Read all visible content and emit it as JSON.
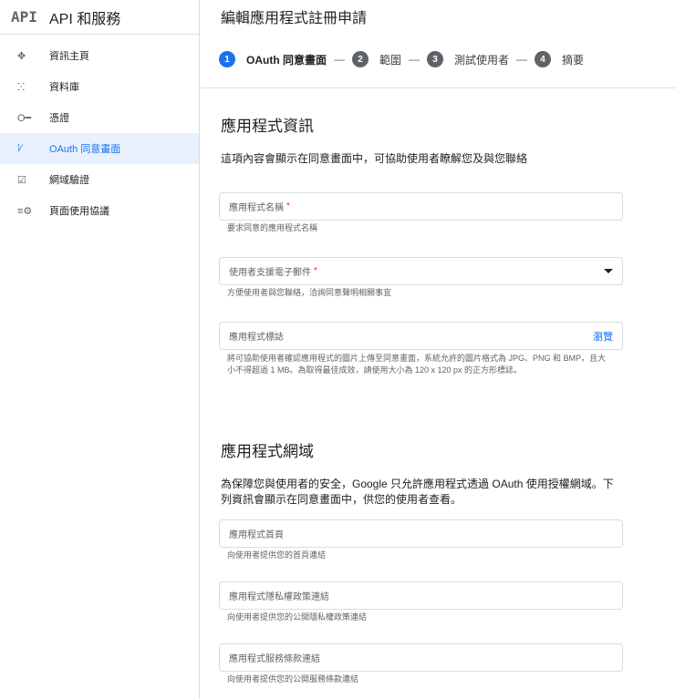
{
  "sidebar": {
    "logo": "API",
    "title": "API 和服務",
    "items": [
      {
        "label": "資訊主頁",
        "icon": "✥"
      },
      {
        "label": "資料庫",
        "icon": "ⵘ"
      },
      {
        "label": "憑證",
        "icon": "O━"
      },
      {
        "label": "OAuth 同意畫面",
        "icon": "⁞⁄"
      },
      {
        "label": "網域驗證",
        "icon": "☑"
      },
      {
        "label": "頁面使用協議",
        "icon": "≡⚙"
      }
    ]
  },
  "main": {
    "title": "編輯應用程式註冊申請",
    "steps": [
      {
        "num": "1",
        "label": "OAuth 同意畫面"
      },
      {
        "num": "2",
        "label": "範圍"
      },
      {
        "num": "3",
        "label": "測試使用者"
      },
      {
        "num": "4",
        "label": "摘要"
      }
    ],
    "sep": "—",
    "section1": {
      "title": "應用程式資訊",
      "desc": "這項內容會顯示在同意畫面中，可協助使用者瞭解您及與您聯絡",
      "fields": [
        {
          "label": "應用程式名稱",
          "required": "*",
          "help": "要求同意的應用程式名稱"
        },
        {
          "label": "使用者支援電子郵件",
          "required": "*",
          "help": "方便使用者與您聯絡，洽詢同意聲明相關事宜"
        },
        {
          "label": "應用程式標誌",
          "action": "瀏覽",
          "help": "將可協助使用者確認應用程式的圖片上傳至同意畫面，系統允許的圖片格式為 JPG、PNG 和 BMP，且大小不得超過 1 MB。為取得最佳成效，請使用大小為 120 x 120 px 的正方形標誌。"
        }
      ]
    },
    "section2": {
      "title": "應用程式網域",
      "desc": "為保障您與使用者的安全，Google 只允許應用程式透過 OAuth 使用授權網域。下列資訊會顯示在同意畫面中，供您的使用者查看。",
      "fields": [
        {
          "label": "應用程式首頁",
          "help": "向使用者提供您的首頁連結"
        },
        {
          "label": "應用程式隱私權政策連結",
          "help": "向使用者提供您的公開隱私權政策連結"
        },
        {
          "label": "應用程式服務條款連結",
          "help": "向使用者提供您的公開服務條款連結"
        }
      ]
    }
  }
}
